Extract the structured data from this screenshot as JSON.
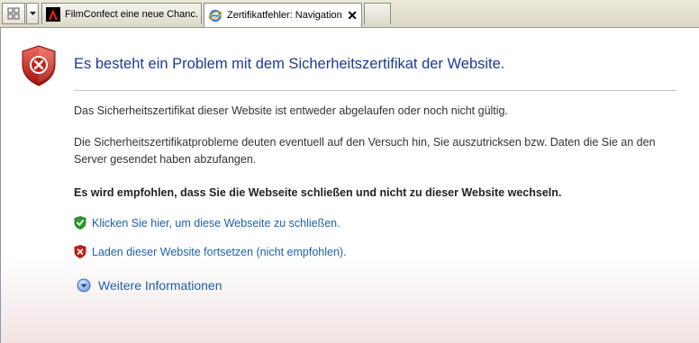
{
  "tabs": [
    {
      "label": "FilmConfect eine neue Chanc...",
      "icon": "adobe-icon",
      "active": false
    },
    {
      "label": "Zertifikatfehler: Navigation...",
      "icon": "ie-icon",
      "active": true,
      "close": "✕"
    }
  ],
  "page": {
    "title": "Es besteht ein Problem mit dem Sicherheitszertifikat der Website.",
    "paragraph1": "Das Sicherheitszertifikat dieser Website ist entweder abgelaufen oder noch nicht gültig.",
    "paragraph2": "Die Sicherheitszertifikatprobleme deuten eventuell auf den Versuch hin, Sie auszutricksen bzw. Daten die Sie an den Server gesendet haben abzufangen.",
    "recommendation": "Es wird empfohlen, dass Sie die Webseite schließen und nicht zu dieser Website wechseln.",
    "close_link": "Klicken Sie hier, um diese Webseite zu schließen.",
    "continue_link": "Laden dieser Website fortsetzen (nicht empfohlen).",
    "more_info": "Weitere Informationen"
  },
  "colors": {
    "title": "#1f3a93",
    "link": "#1f5fa8",
    "shield_red": "#c8211b",
    "shield_green": "#2f9a2f"
  }
}
